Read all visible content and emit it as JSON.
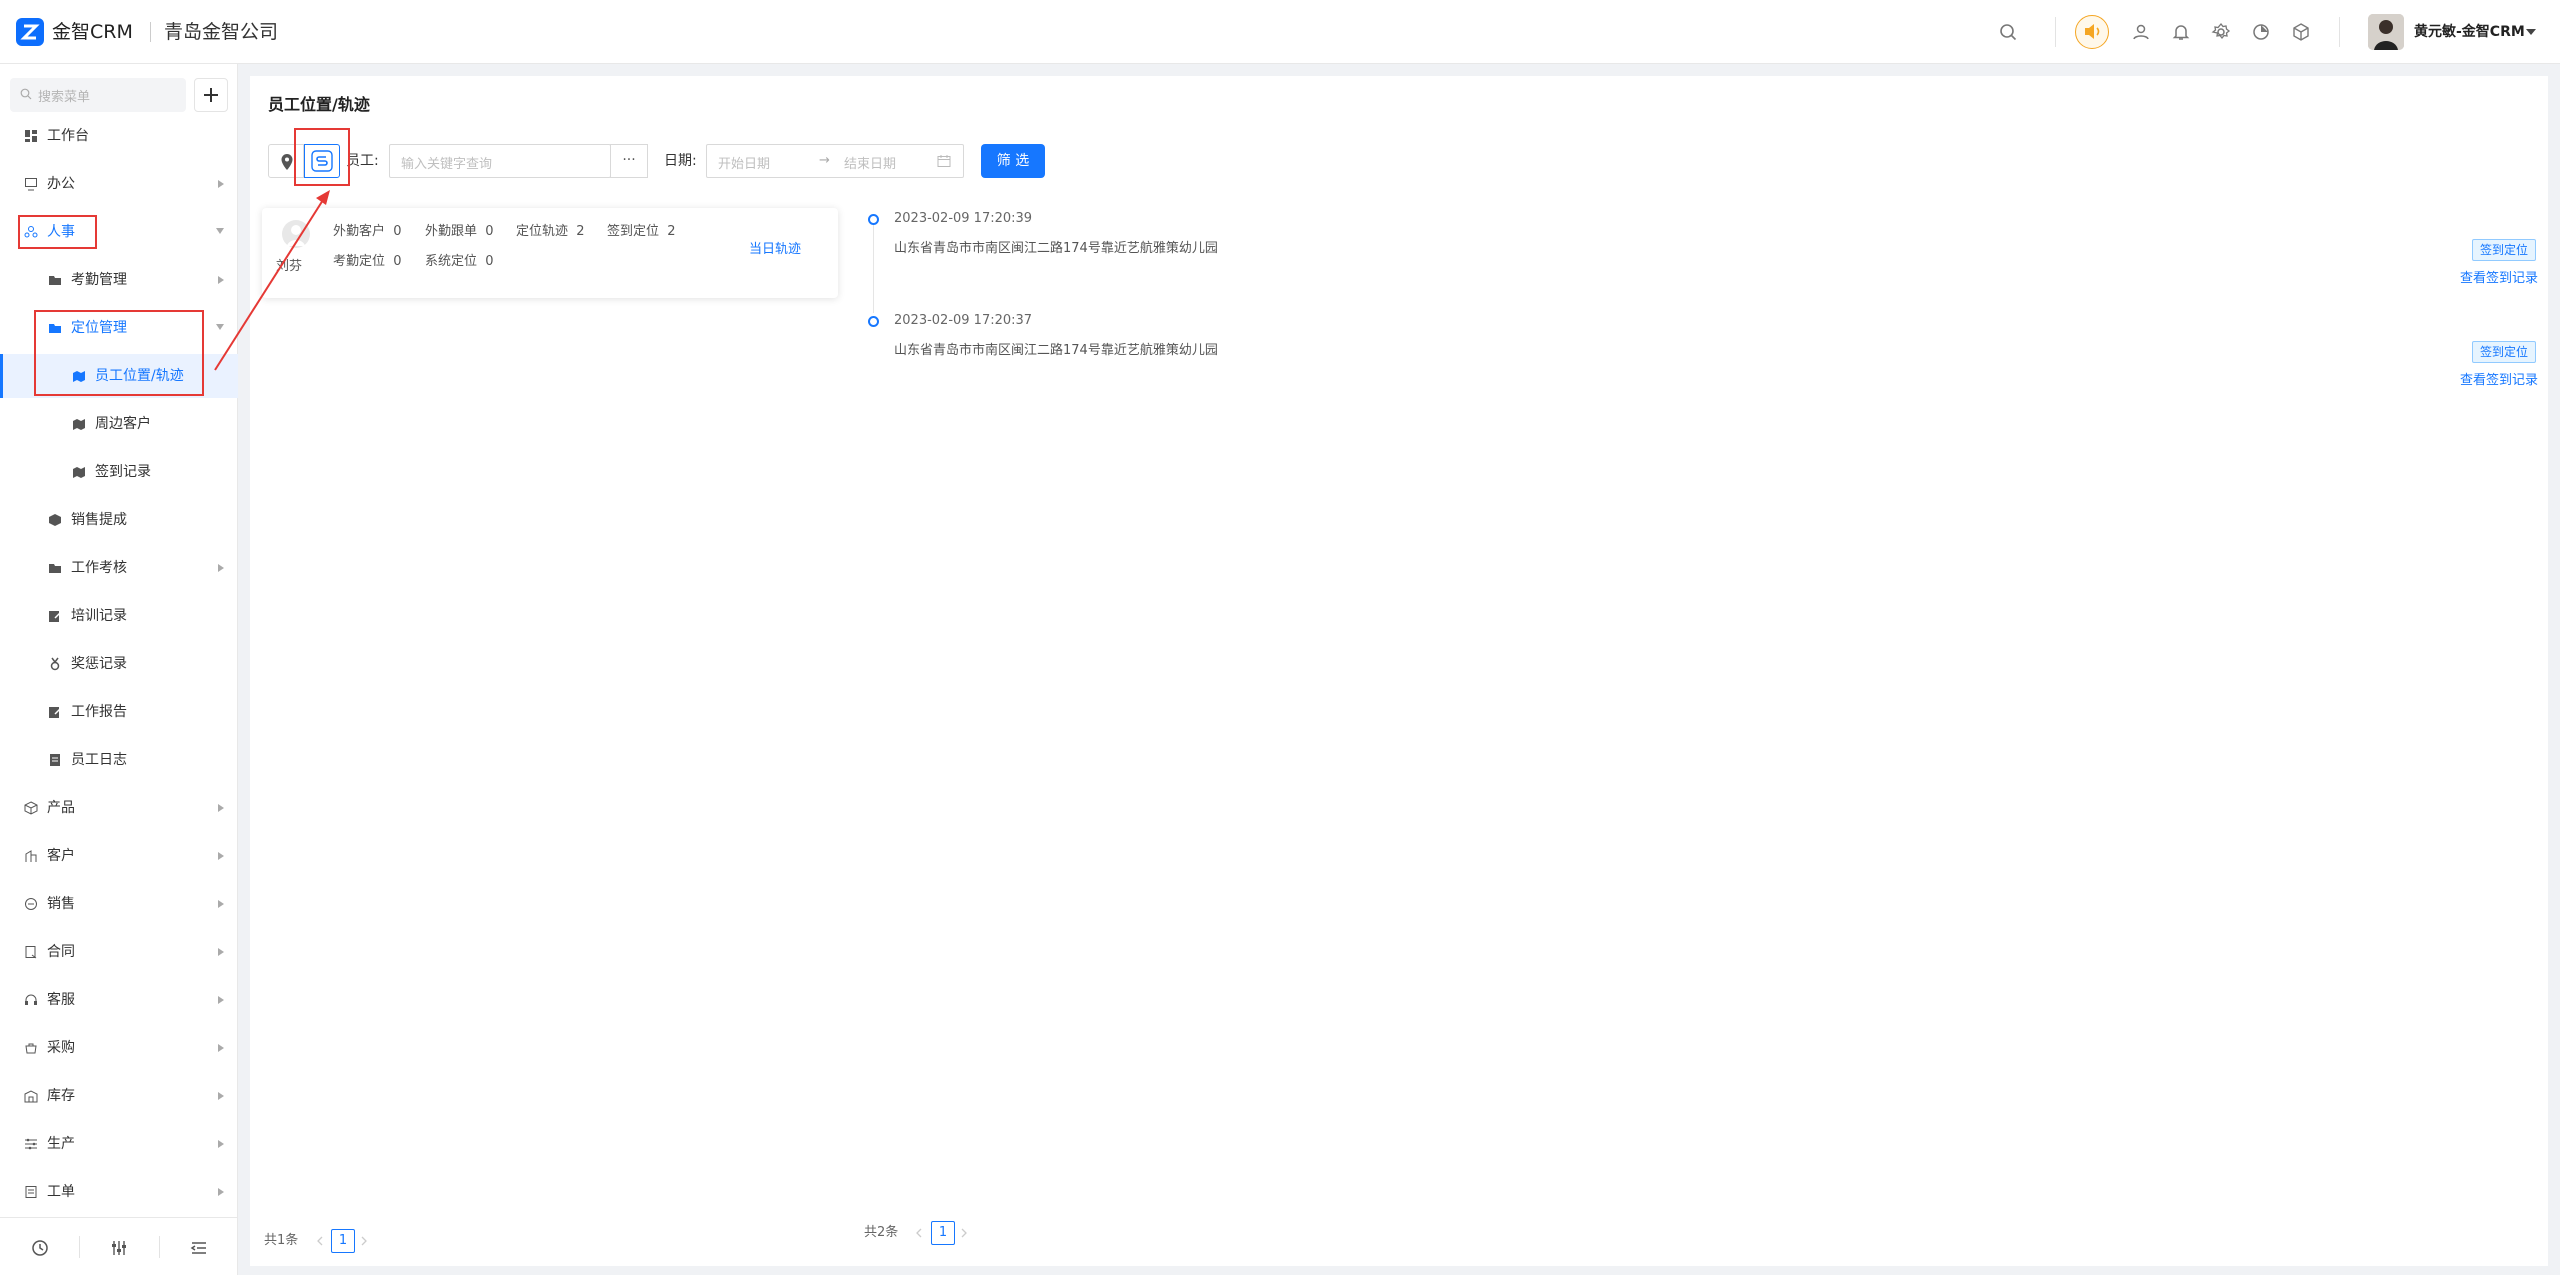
{
  "header": {
    "app_name": "金智CRM",
    "company": "青岛金智公司",
    "user_name": "黄元敏-金智CRM",
    "icons": [
      "search-icon",
      "speaker-icon",
      "contacts-icon",
      "bell-icon",
      "settings-icon",
      "pie-chart-icon",
      "cube-icon"
    ]
  },
  "sidebar": {
    "search_placeholder": "搜索菜单",
    "add_label": "+",
    "items": [
      {
        "label": "工作台",
        "icon": "dashboard-icon"
      },
      {
        "label": "办公",
        "icon": "office-icon"
      },
      {
        "label": "人事",
        "icon": "hr-icon"
      },
      {
        "label": "考勤管理",
        "icon": "folder-icon"
      },
      {
        "label": "定位管理",
        "icon": "folder-icon"
      },
      {
        "label": "员工位置/轨迹",
        "icon": "map-icon"
      },
      {
        "label": "周边客户",
        "icon": "map-icon"
      },
      {
        "label": "签到记录",
        "icon": "map-icon"
      },
      {
        "label": "销售提成",
        "icon": "coin-icon"
      },
      {
        "label": "工作考核",
        "icon": "folder-icon"
      },
      {
        "label": "培训记录",
        "icon": "edit-icon"
      },
      {
        "label": "奖惩记录",
        "icon": "medal-icon"
      },
      {
        "label": "工作报告",
        "icon": "edit-icon"
      },
      {
        "label": "员工日志",
        "icon": "doc-icon"
      },
      {
        "label": "产品",
        "icon": "box-icon"
      },
      {
        "label": "客户",
        "icon": "customer-icon"
      },
      {
        "label": "销售",
        "icon": "sales-icon"
      },
      {
        "label": "合同",
        "icon": "contract-icon"
      },
      {
        "label": "客服",
        "icon": "headset-icon"
      },
      {
        "label": "采购",
        "icon": "cart-icon"
      },
      {
        "label": "库存",
        "icon": "warehouse-icon"
      },
      {
        "label": "生产",
        "icon": "factory-icon"
      },
      {
        "label": "工单",
        "icon": "ticket-icon"
      }
    ],
    "footer_icons": [
      "history-icon",
      "tune-icon",
      "menu-collapse-icon"
    ]
  },
  "page": {
    "title": "员工位置/轨迹",
    "employee_label": "员工:",
    "employee_placeholder": "输入关键字查询",
    "more_label": "···",
    "date_label": "日期:",
    "start_placeholder": "开始日期",
    "end_placeholder": "结束日期",
    "date_sep": "→",
    "filter_button": "筛 选"
  },
  "employee_card": {
    "name": "刘芬",
    "stats": [
      {
        "label": "外勤客户",
        "value": "0"
      },
      {
        "label": "外勤跟单",
        "value": "0"
      },
      {
        "label": "定位轨迹",
        "value": "2"
      },
      {
        "label": "签到定位",
        "value": "2"
      },
      {
        "label": "考勤定位",
        "value": "0"
      },
      {
        "label": "系统定位",
        "value": "0"
      }
    ],
    "link": "当日轨迹"
  },
  "timeline": [
    {
      "time": "2023-02-09 17:20:39",
      "address": "山东省青岛市市南区闽江二路174号靠近艺航雅策幼儿园",
      "tag": "签到定位",
      "link": "查看签到记录"
    },
    {
      "time": "2023-02-09 17:20:37",
      "address": "山东省青岛市市南区闽江二路174号靠近艺航雅策幼儿园",
      "tag": "签到定位",
      "link": "查看签到记录"
    }
  ],
  "pagination_left": {
    "total": "共1条",
    "page": "1"
  },
  "pagination_right": {
    "total": "共2条",
    "page": "1"
  },
  "colors": {
    "accent": "#1677ff",
    "annotation": "#e53935"
  }
}
